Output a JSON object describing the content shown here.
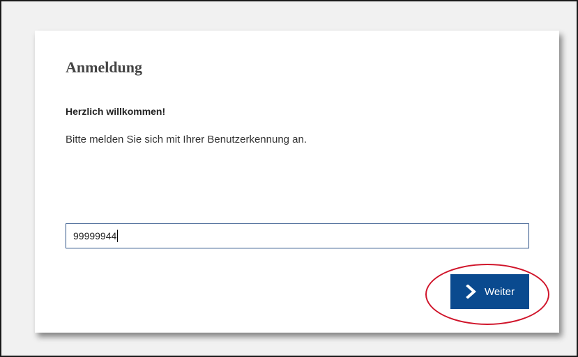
{
  "login": {
    "title": "Anmeldung",
    "welcome": "Herzlich willkommen!",
    "instruction": "Bitte melden Sie sich mit Ihrer Benutzerkennung an.",
    "user_id_value": "99999944",
    "submit_label": "Weiter"
  },
  "icons": {
    "submit": "chevron-right-icon"
  },
  "colors": {
    "button_background": "#0a4a8f",
    "input_border": "#2a4f86",
    "highlight_ring": "#d0142a"
  }
}
